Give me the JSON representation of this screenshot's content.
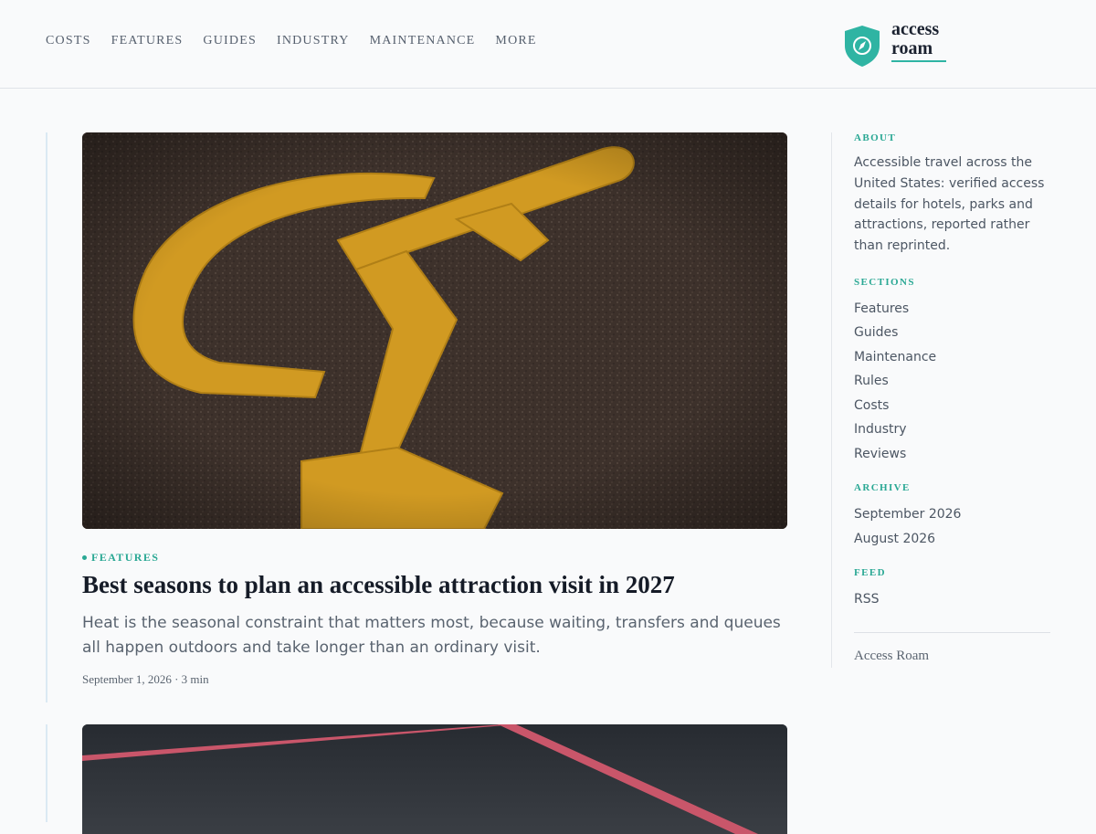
{
  "nav": {
    "items": [
      "COSTS",
      "FEATURES",
      "GUIDES",
      "INDUSTRY",
      "MAINTENANCE",
      "MORE"
    ]
  },
  "logo": {
    "line1": "access",
    "line2": "roam",
    "icon": "compass-shield-icon",
    "accent": "#2fb4a3"
  },
  "articles": [
    {
      "image": "wheelchair-parking-symbol-image",
      "category": "FEATURES",
      "title": "Best seasons to plan an accessible attraction visit in 2027",
      "dek": "Heat is the seasonal constraint that matters most, because waiting, transfers and queues all happen outdoors and take longer than an ordinary visit.",
      "meta": "September 1, 2026 · 3 min"
    },
    {
      "image": "parking-lot-lines-image"
    }
  ],
  "sidebar": {
    "about": {
      "heading": "ABOUT",
      "text": "Accessible travel across the United States: verified access details for hotels, parks and attractions, reported rather than reprinted."
    },
    "sections": {
      "heading": "SECTIONS",
      "items": [
        "Features",
        "Guides",
        "Maintenance",
        "Rules",
        "Costs",
        "Industry",
        "Reviews"
      ]
    },
    "archive": {
      "heading": "ARCHIVE",
      "items": [
        "September 2026",
        "August 2026"
      ]
    },
    "feed": {
      "heading": "FEED",
      "items": [
        "RSS"
      ]
    },
    "footer": "Access Roam"
  },
  "colors": {
    "accent": "#2aa894",
    "background": "#f9fafb",
    "text": "#151b27"
  }
}
